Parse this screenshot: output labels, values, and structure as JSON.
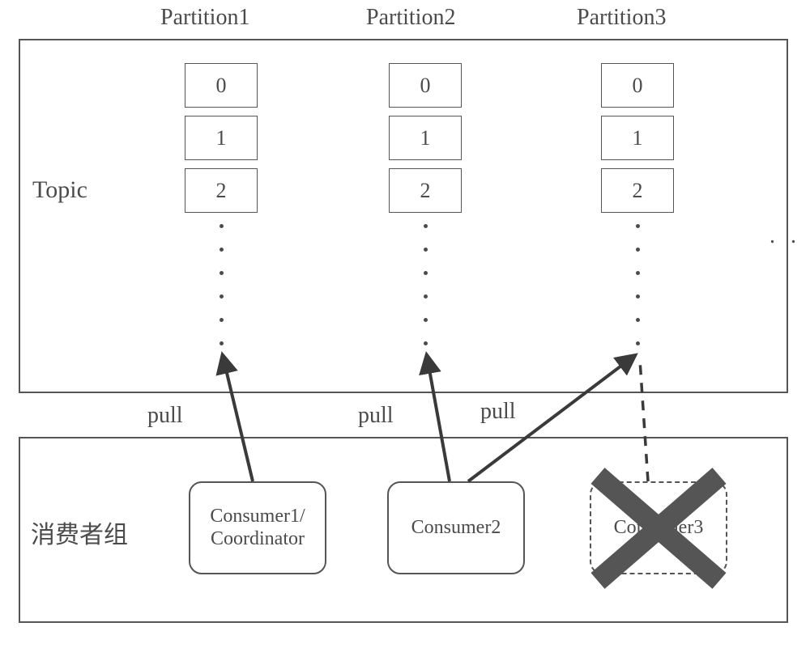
{
  "header": {
    "partition1": "Partition1",
    "partition2": "Partition2",
    "partition3": "Partition3"
  },
  "topic": {
    "label": "Topic",
    "partitions": [
      {
        "cells": [
          "0",
          "1",
          "2"
        ]
      },
      {
        "cells": [
          "0",
          "1",
          "2"
        ]
      },
      {
        "cells": [
          "0",
          "1",
          "2"
        ]
      }
    ],
    "ellipsis": ". . ."
  },
  "pull": {
    "label1": "pull",
    "label2": "pull",
    "label3": "pull"
  },
  "group": {
    "label": "消费者组",
    "consumer1": "Consumer1/\nCoordinator",
    "consumer2": "Consumer2",
    "consumer3": "Consumer3"
  }
}
